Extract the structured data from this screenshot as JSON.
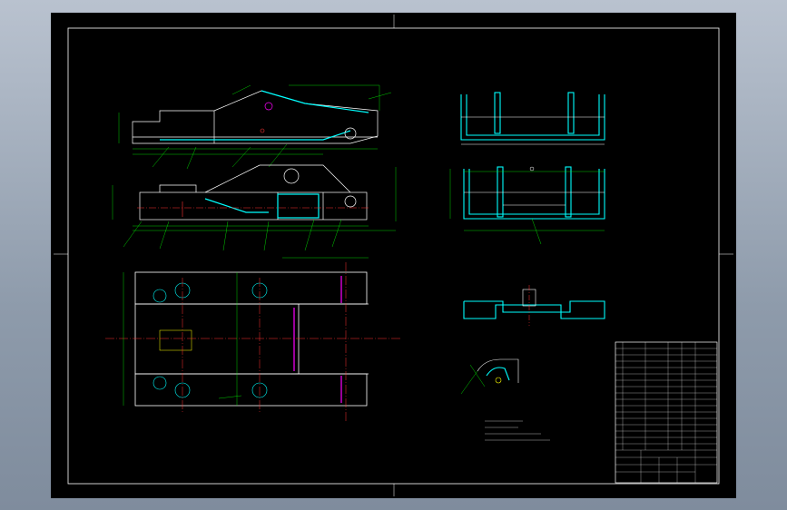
{
  "app": {
    "name": "",
    "background": "#000000",
    "colors": {
      "outline": "#ffffff",
      "dimension": "#00ff00",
      "section": "#00ffff",
      "center": "#ff3333",
      "hidden": "#ffff00",
      "highlight": "#ff00ff",
      "text": "#e8e8e8"
    }
  },
  "views": {
    "elevation_upper": {
      "label": ""
    },
    "elevation_lower": {
      "label": ""
    },
    "plan": {
      "label": ""
    },
    "section_a": {
      "label": ""
    },
    "section_b": {
      "label": ""
    },
    "section_c": {
      "label": ""
    },
    "detail": {
      "label": ""
    }
  },
  "notes": {
    "items": [
      "",
      "",
      "",
      ""
    ]
  },
  "title_block": {
    "drawing_title": "",
    "material": "",
    "scale": ""
  }
}
